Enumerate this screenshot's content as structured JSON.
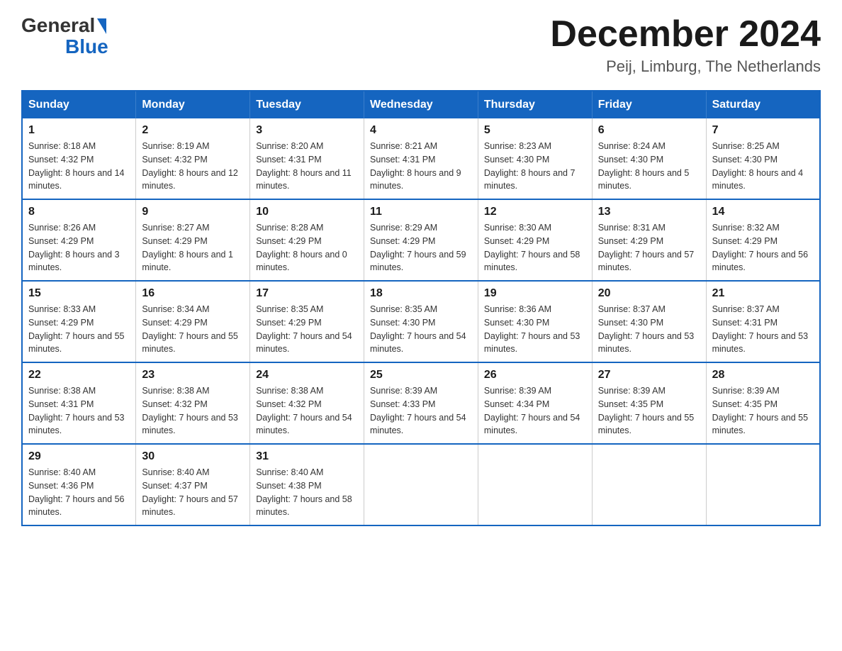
{
  "header": {
    "logo": {
      "general": "General",
      "blue": "Blue"
    },
    "title": "December 2024",
    "location": "Peij, Limburg, The Netherlands"
  },
  "calendar": {
    "days_of_week": [
      "Sunday",
      "Monday",
      "Tuesday",
      "Wednesday",
      "Thursday",
      "Friday",
      "Saturday"
    ],
    "weeks": [
      [
        {
          "day": "1",
          "sunrise": "8:18 AM",
          "sunset": "4:32 PM",
          "daylight": "8 hours and 14 minutes."
        },
        {
          "day": "2",
          "sunrise": "8:19 AM",
          "sunset": "4:32 PM",
          "daylight": "8 hours and 12 minutes."
        },
        {
          "day": "3",
          "sunrise": "8:20 AM",
          "sunset": "4:31 PM",
          "daylight": "8 hours and 11 minutes."
        },
        {
          "day": "4",
          "sunrise": "8:21 AM",
          "sunset": "4:31 PM",
          "daylight": "8 hours and 9 minutes."
        },
        {
          "day": "5",
          "sunrise": "8:23 AM",
          "sunset": "4:30 PM",
          "daylight": "8 hours and 7 minutes."
        },
        {
          "day": "6",
          "sunrise": "8:24 AM",
          "sunset": "4:30 PM",
          "daylight": "8 hours and 5 minutes."
        },
        {
          "day": "7",
          "sunrise": "8:25 AM",
          "sunset": "4:30 PM",
          "daylight": "8 hours and 4 minutes."
        }
      ],
      [
        {
          "day": "8",
          "sunrise": "8:26 AM",
          "sunset": "4:29 PM",
          "daylight": "8 hours and 3 minutes."
        },
        {
          "day": "9",
          "sunrise": "8:27 AM",
          "sunset": "4:29 PM",
          "daylight": "8 hours and 1 minute."
        },
        {
          "day": "10",
          "sunrise": "8:28 AM",
          "sunset": "4:29 PM",
          "daylight": "8 hours and 0 minutes."
        },
        {
          "day": "11",
          "sunrise": "8:29 AM",
          "sunset": "4:29 PM",
          "daylight": "7 hours and 59 minutes."
        },
        {
          "day": "12",
          "sunrise": "8:30 AM",
          "sunset": "4:29 PM",
          "daylight": "7 hours and 58 minutes."
        },
        {
          "day": "13",
          "sunrise": "8:31 AM",
          "sunset": "4:29 PM",
          "daylight": "7 hours and 57 minutes."
        },
        {
          "day": "14",
          "sunrise": "8:32 AM",
          "sunset": "4:29 PM",
          "daylight": "7 hours and 56 minutes."
        }
      ],
      [
        {
          "day": "15",
          "sunrise": "8:33 AM",
          "sunset": "4:29 PM",
          "daylight": "7 hours and 55 minutes."
        },
        {
          "day": "16",
          "sunrise": "8:34 AM",
          "sunset": "4:29 PM",
          "daylight": "7 hours and 55 minutes."
        },
        {
          "day": "17",
          "sunrise": "8:35 AM",
          "sunset": "4:29 PM",
          "daylight": "7 hours and 54 minutes."
        },
        {
          "day": "18",
          "sunrise": "8:35 AM",
          "sunset": "4:30 PM",
          "daylight": "7 hours and 54 minutes."
        },
        {
          "day": "19",
          "sunrise": "8:36 AM",
          "sunset": "4:30 PM",
          "daylight": "7 hours and 53 minutes."
        },
        {
          "day": "20",
          "sunrise": "8:37 AM",
          "sunset": "4:30 PM",
          "daylight": "7 hours and 53 minutes."
        },
        {
          "day": "21",
          "sunrise": "8:37 AM",
          "sunset": "4:31 PM",
          "daylight": "7 hours and 53 minutes."
        }
      ],
      [
        {
          "day": "22",
          "sunrise": "8:38 AM",
          "sunset": "4:31 PM",
          "daylight": "7 hours and 53 minutes."
        },
        {
          "day": "23",
          "sunrise": "8:38 AM",
          "sunset": "4:32 PM",
          "daylight": "7 hours and 53 minutes."
        },
        {
          "day": "24",
          "sunrise": "8:38 AM",
          "sunset": "4:32 PM",
          "daylight": "7 hours and 54 minutes."
        },
        {
          "day": "25",
          "sunrise": "8:39 AM",
          "sunset": "4:33 PM",
          "daylight": "7 hours and 54 minutes."
        },
        {
          "day": "26",
          "sunrise": "8:39 AM",
          "sunset": "4:34 PM",
          "daylight": "7 hours and 54 minutes."
        },
        {
          "day": "27",
          "sunrise": "8:39 AM",
          "sunset": "4:35 PM",
          "daylight": "7 hours and 55 minutes."
        },
        {
          "day": "28",
          "sunrise": "8:39 AM",
          "sunset": "4:35 PM",
          "daylight": "7 hours and 55 minutes."
        }
      ],
      [
        {
          "day": "29",
          "sunrise": "8:40 AM",
          "sunset": "4:36 PM",
          "daylight": "7 hours and 56 minutes."
        },
        {
          "day": "30",
          "sunrise": "8:40 AM",
          "sunset": "4:37 PM",
          "daylight": "7 hours and 57 minutes."
        },
        {
          "day": "31",
          "sunrise": "8:40 AM",
          "sunset": "4:38 PM",
          "daylight": "7 hours and 58 minutes."
        },
        null,
        null,
        null,
        null
      ]
    ]
  }
}
